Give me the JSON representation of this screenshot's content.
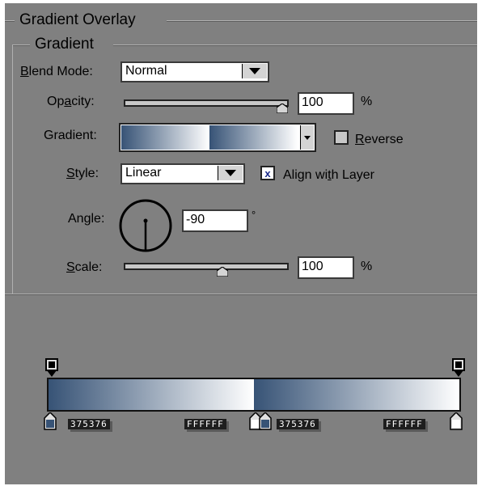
{
  "header": {
    "title": "Gradient Overlay"
  },
  "group": {
    "title": "Gradient"
  },
  "blend_mode": {
    "label_prefix": "B",
    "label_rest": "lend Mode:",
    "value": "Normal"
  },
  "opacity": {
    "label_prefix": "Op",
    "label_ul": "a",
    "label_rest": "city:",
    "value": "100",
    "unit": "%",
    "level": 1.0
  },
  "gradient": {
    "label": "Gradient:",
    "reverse_label_ul": "R",
    "reverse_label_rest": "everse",
    "reverse_checked": false
  },
  "style": {
    "label_ul": "S",
    "label_rest": "tyle:",
    "value": "Linear",
    "align_label_pre": "Align wi",
    "align_label_ul": "t",
    "align_label_post": "h Layer",
    "align_checked": true
  },
  "angle": {
    "label_pre": "An",
    "label_ul": "g",
    "label_post": "le:",
    "value": "-90",
    "unit": "°"
  },
  "scale": {
    "label_ul": "S",
    "label_rest": "cale:",
    "value": "100",
    "unit": "%",
    "level": 0.5
  },
  "editor": {
    "stops": [
      {
        "position": 0.0,
        "color": "375376",
        "hex": "#375376"
      },
      {
        "position": 0.5,
        "color": "FFFFFF",
        "hex": "#ffffff"
      },
      {
        "position": 0.5,
        "color": "375376",
        "hex": "#375376"
      },
      {
        "position": 1.0,
        "color": "FFFFFF",
        "hex": "#ffffff"
      }
    ],
    "colors": {
      "start": "#375376",
      "end": "#ffffff"
    }
  }
}
